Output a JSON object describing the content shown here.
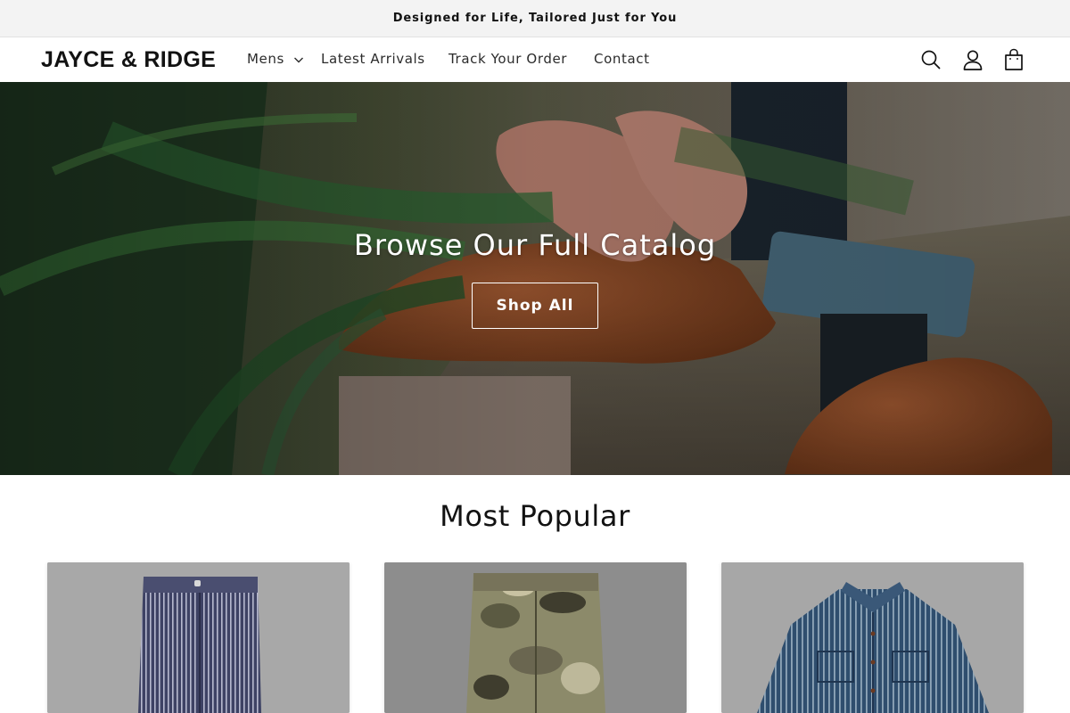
{
  "announcement": {
    "text": "Designed for Life, Tailored Just for You"
  },
  "header": {
    "logo": "JAYCE & RIDGE",
    "nav": {
      "mens": "Mens",
      "latest_arrivals": "Latest Arrivals",
      "track_order": "Track Your Order",
      "contact": "Contact"
    },
    "icons": [
      "search-icon",
      "account-icon",
      "cart-icon"
    ]
  },
  "hero": {
    "title": "Browse Our Full Catalog",
    "button_label": "Shop All"
  },
  "popular": {
    "title": "Most Popular",
    "products": [
      {
        "image": "striped-work-pants"
      },
      {
        "image": "camo-cargo-pants"
      },
      {
        "image": "striped-denim-shirt"
      }
    ]
  },
  "colors": {
    "announcement_bg": "#f3f3f3",
    "text": "#121212",
    "hero_text": "#ffffff"
  }
}
